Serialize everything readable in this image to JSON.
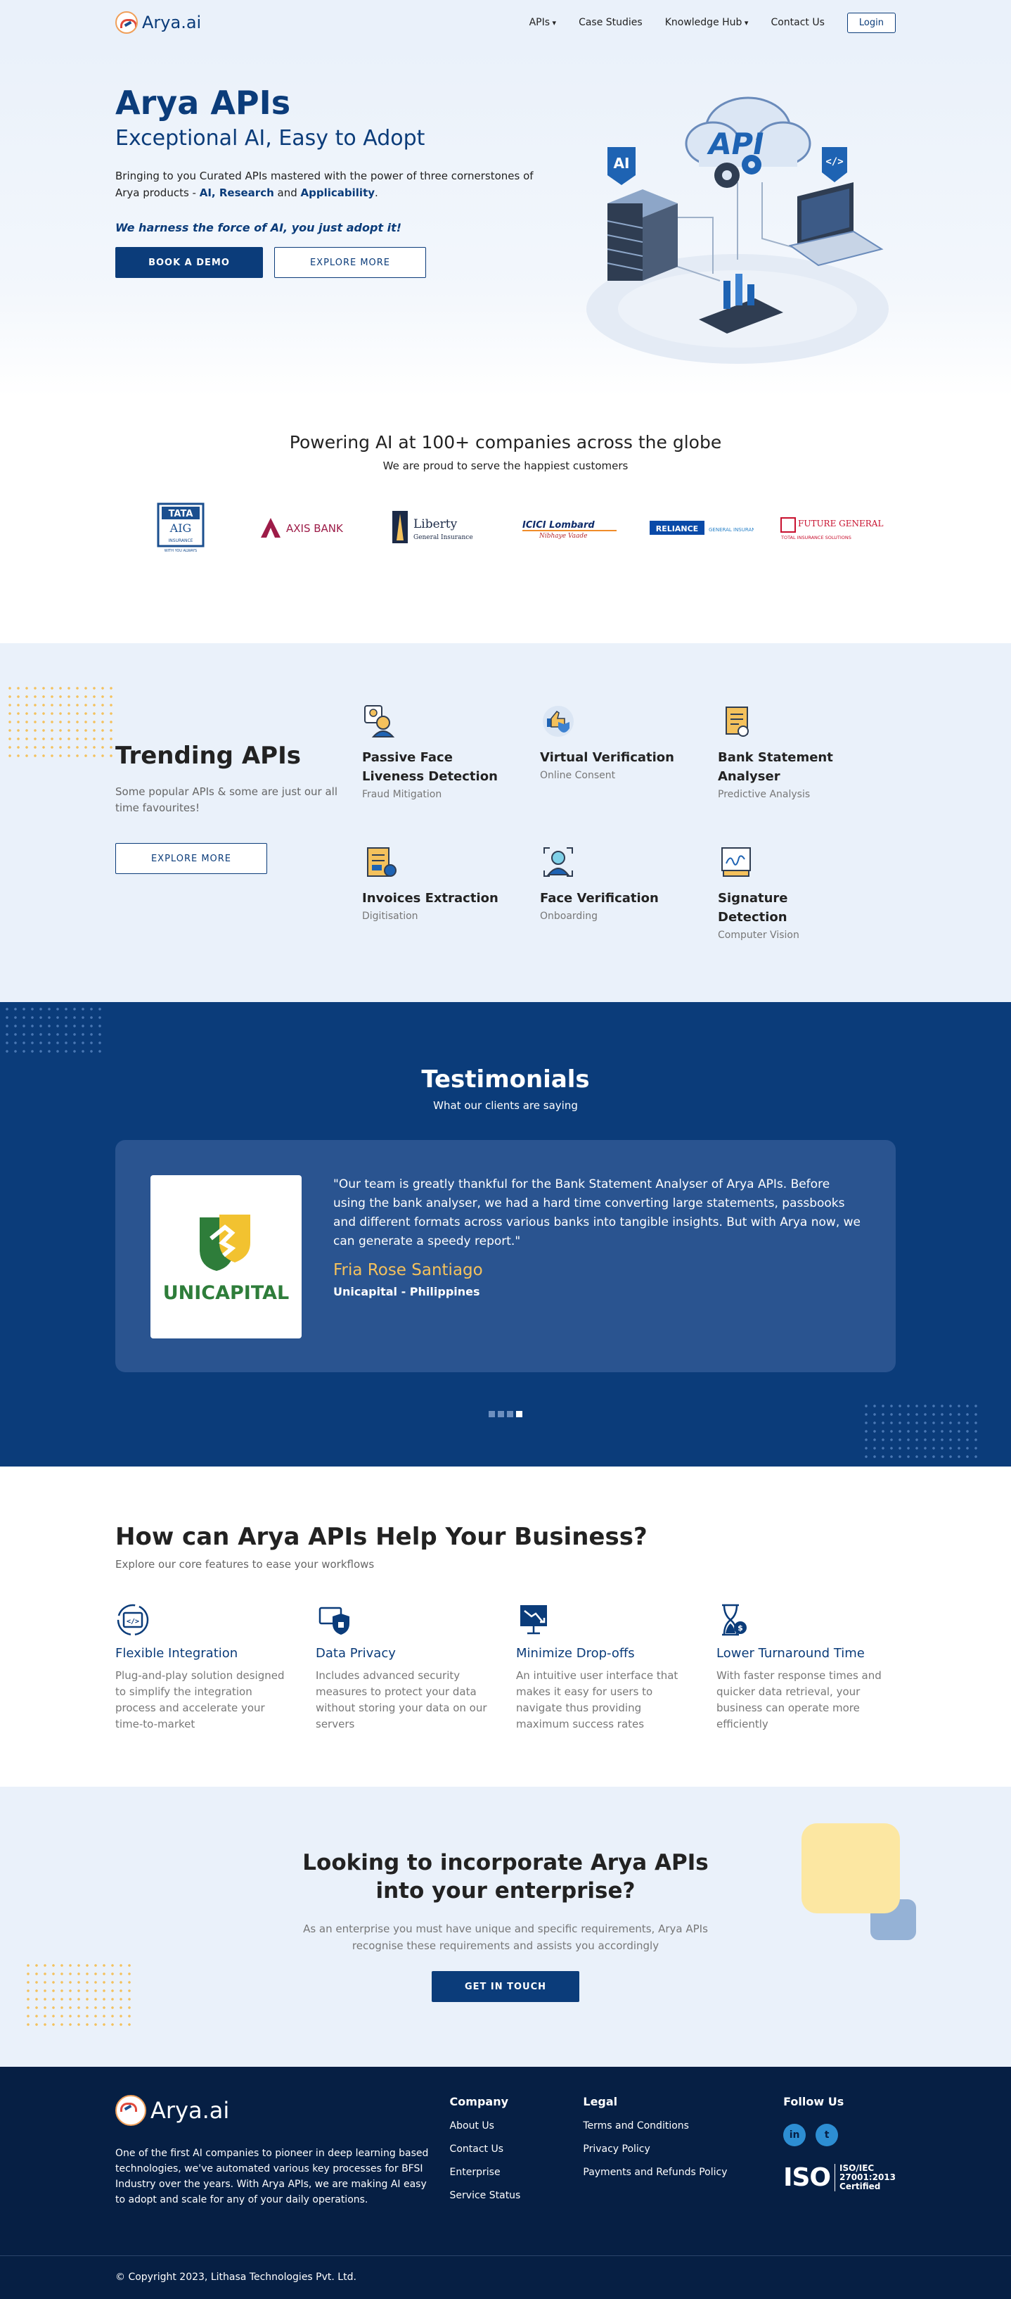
{
  "nav": {
    "brand": "Arya.ai",
    "links": [
      "APIs",
      "Case Studies",
      "Knowledge Hub",
      "Contact Us"
    ],
    "login": "Login"
  },
  "hero": {
    "title": "Arya APIs",
    "subtitle": "Exceptional AI, Easy to Adopt",
    "desc_pre": "Bringing to you Curated APIs mastered with the power of three cornerstones of Arya products - ",
    "kw1": "AI, Research",
    "and": " and ",
    "kw2": "Applicability",
    "dot": ".",
    "tagline": "We harness the force of AI, you just adopt it!",
    "btn_demo": "BOOK A DEMO",
    "btn_explore": "EXPLORE MORE",
    "art_labels": [
      "API",
      "AI"
    ]
  },
  "clients": {
    "heading": "Powering AI at 100+ companies across the globe",
    "sub": "We are proud to serve the happiest customers",
    "logos": [
      {
        "name": "TATA AIG",
        "sub": "INSURANCE",
        "tag": "WITH YOU ALWAYS"
      },
      {
        "name": "AXIS BANK"
      },
      {
        "name": "Liberty",
        "sub": "General Insurance"
      },
      {
        "name": "ICICI Lombard",
        "sub": "Nibhaye Vaade"
      },
      {
        "name": "RELIANCE",
        "sub": "GENERAL INSURANCE"
      },
      {
        "name": "FUTURE GENERALI",
        "sub": "TOTAL INSURANCE SOLUTIONS"
      }
    ]
  },
  "trending": {
    "title": "Trending APIs",
    "desc": "Some popular APIs & some are just our all time favourites!",
    "btn": "EXPLORE MORE",
    "items": [
      {
        "name": "Passive Face Liveness Detection",
        "cat": "Fraud Mitigation",
        "icon": "face-liveness-icon"
      },
      {
        "name": "Virtual Verification",
        "cat": "Online Consent",
        "icon": "virtual-verification-icon"
      },
      {
        "name": "Bank Statement Analyser",
        "cat": "Predictive Analysis",
        "icon": "bank-statement-icon"
      },
      {
        "name": "Invoices Extraction",
        "cat": "Digitisation",
        "icon": "invoice-icon"
      },
      {
        "name": "Face Verification",
        "cat": "Onboarding",
        "icon": "face-verification-icon"
      },
      {
        "name": "Signature Detection",
        "cat": "Computer Vision",
        "icon": "signature-icon"
      }
    ]
  },
  "testimonials": {
    "title": "Testimonials",
    "sub": "What our clients are saying",
    "logo_text": "UNICAPITAL",
    "quote": "\"Our team is greatly thankful for the Bank Statement Analyser of Arya APIs. Before using the bank analyser, we had a hard time converting large statements, passbooks and different formats across various banks into tangible insights. But with Arya now, we can generate a speedy report.\"",
    "name": "Fria Rose Santiago",
    "company": "Unicapital - Philippines",
    "slides": 4,
    "active_slide": 4
  },
  "help": {
    "title": "How can Arya APIs Help Your Business?",
    "sub": "Explore our core features to ease your workflows",
    "items": [
      {
        "title": "Flexible Integration",
        "desc": "Plug-and-play solution designed to simplify the integration process and accelerate your time-to-market",
        "icon": "code-integration-icon"
      },
      {
        "title": "Data Privacy",
        "desc": "Includes advanced security measures to protect your data without storing your data on our servers",
        "icon": "shield-lock-icon"
      },
      {
        "title": "Minimize Drop-offs",
        "desc": "An intuitive user interface that makes it easy for users to navigate thus providing maximum success rates",
        "icon": "chart-down-icon"
      },
      {
        "title": "Lower Turnaround Time",
        "desc": "With faster response times and quicker data retrieval, your business can operate more efficiently",
        "icon": "hourglass-icon"
      }
    ]
  },
  "enterprise": {
    "title": "Looking to incorporate Arya APIs into your enterprise?",
    "desc": "As an enterprise you must have unique and specific requirements, Arya APIs recognise these requirements and assists you accordingly",
    "btn": "GET IN TOUCH"
  },
  "footer": {
    "brand": "Arya.ai",
    "about": "One of the first AI companies to pioneer in deep learning based technologies, we've automated various key processes for BFSI Industry over the years. With Arya APIs, we are making AI easy to adopt and scale for any of your daily operations.",
    "company_title": "Company",
    "company_links": [
      "About Us",
      "Contact Us",
      "Enterprise",
      "Service Status"
    ],
    "legal_title": "Legal",
    "legal_links": [
      "Terms and Conditions",
      "Privacy Policy",
      "Payments and Refunds Policy"
    ],
    "follow_title": "Follow Us",
    "social": [
      "in",
      "t"
    ],
    "iso_mark": "ISO",
    "iso_lines": [
      "ISO/IEC",
      "27001:2013",
      "Certified"
    ],
    "copyright": "© Copyright 2023, Lithasa Technologies Pvt. Ltd."
  },
  "colors": {
    "primary": "#0b3c7a",
    "accent": "#f4c15c",
    "footer": "#061f44",
    "light": "#eaf1fa"
  }
}
